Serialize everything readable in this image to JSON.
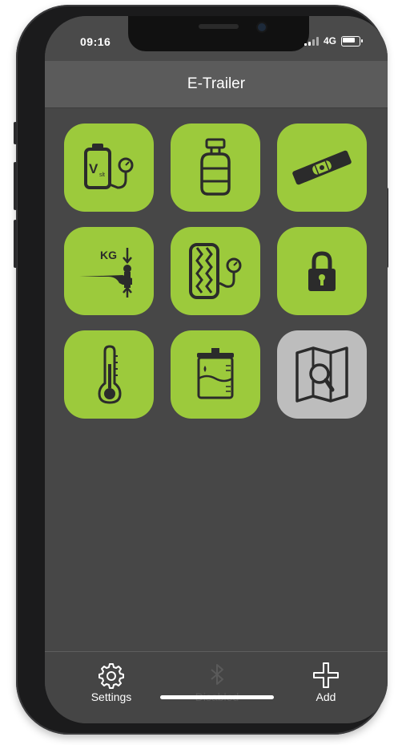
{
  "status": {
    "time": "09:16",
    "network": "4G"
  },
  "header": {
    "title": "E-Trailer"
  },
  "tiles": [
    {
      "name": "battery-voltage",
      "icon": "battery-voltage-icon",
      "label_text": "V",
      "sub_text": "slt"
    },
    {
      "name": "gas-bottle",
      "icon": "gas-bottle-icon"
    },
    {
      "name": "spirit-level",
      "icon": "spirit-level-icon"
    },
    {
      "name": "hitch-load",
      "icon": "hitch-load-icon",
      "label_text": "KG"
    },
    {
      "name": "tire-pressure",
      "icon": "tire-pressure-icon"
    },
    {
      "name": "lock",
      "icon": "padlock-icon"
    },
    {
      "name": "temperature",
      "icon": "thermometer-icon"
    },
    {
      "name": "water-tank",
      "icon": "water-tank-icon"
    },
    {
      "name": "map-search",
      "icon": "map-search-icon",
      "state": "disabled"
    }
  ],
  "tabbar": {
    "settings": {
      "label": "Settings",
      "icon": "gear-icon"
    },
    "bluetooth": {
      "label": "Disabled",
      "icon": "bluetooth-icon",
      "state": "disabled"
    },
    "add": {
      "label": "Add",
      "icon": "plus-icon"
    }
  },
  "colors": {
    "tile_active": "#9cca3c",
    "tile_inactive": "#bdbdbd",
    "background": "#474747",
    "header": "#5b5b5b",
    "icon": "#2b2b2b"
  }
}
